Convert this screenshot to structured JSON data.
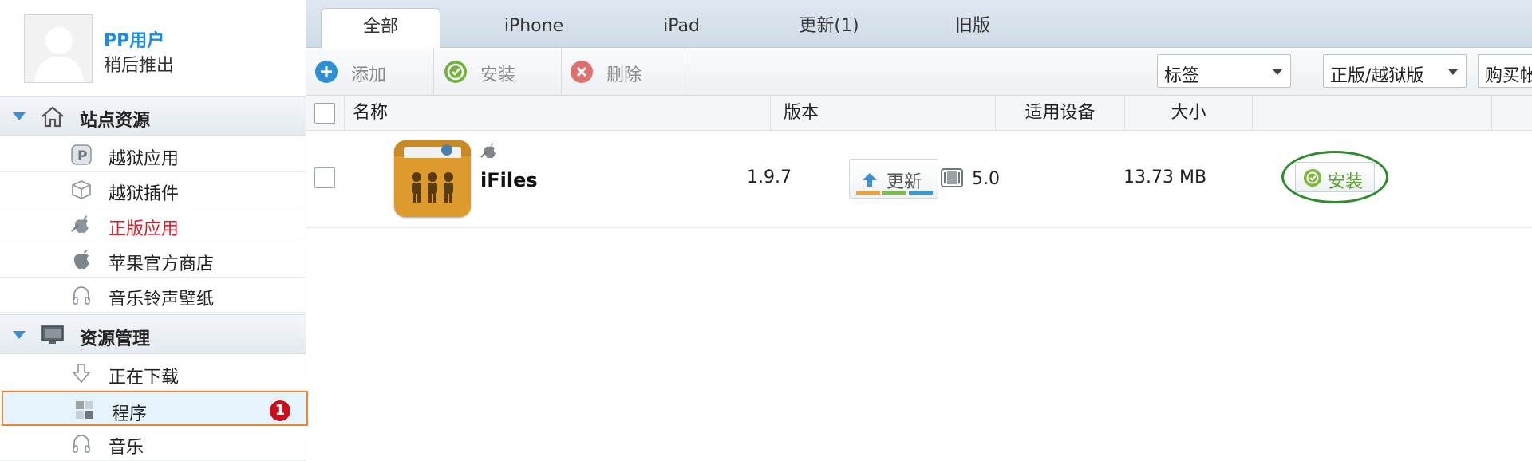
{
  "user": {
    "name": "PP用户",
    "action": "稍后推出"
  },
  "sidebar": {
    "sections": [
      {
        "title": "站点资源",
        "icon": "home-icon"
      },
      {
        "title": "资源管理",
        "icon": "monitor-icon"
      }
    ],
    "site_items": [
      {
        "label": "越狱应用",
        "icon": "pp-icon"
      },
      {
        "label": "越狱插件",
        "icon": "plugin-box-icon"
      },
      {
        "label": "正版应用",
        "icon": "apple-store-icon"
      },
      {
        "label": "苹果官方商店",
        "icon": "apple-icon"
      },
      {
        "label": "音乐铃声壁纸",
        "icon": "headphones-icon"
      }
    ],
    "manage_items": [
      {
        "label": "正在下载",
        "icon": "download-arrow-icon"
      },
      {
        "label": "程序",
        "icon": "grid-icon",
        "badge": "1"
      },
      {
        "label": "音乐",
        "icon": "headphones-icon"
      }
    ]
  },
  "tabs": [
    "全部",
    "iPhone",
    "iPad",
    "更新(1)",
    "旧版"
  ],
  "toolbar": {
    "add_label": "添加",
    "install_label": "安装",
    "delete_label": "删除",
    "tag_select": "标签",
    "edition_select": "正版/越狱版",
    "purchase_select": "购买帐"
  },
  "table": {
    "headers": {
      "name": "名称",
      "version": "版本",
      "device": "适用设备",
      "size": "大小"
    },
    "rows": [
      {
        "name": "iFiles",
        "version": "1.9.7",
        "update_label": "更新",
        "device": "5.0",
        "size": "13.73 MB",
        "install_label": "安装"
      }
    ]
  },
  "colors": {
    "accent": "#1a8be0",
    "highlight_border": "#e8872b",
    "badge": "#c8101c",
    "install_circle": "#2e8b2e"
  }
}
